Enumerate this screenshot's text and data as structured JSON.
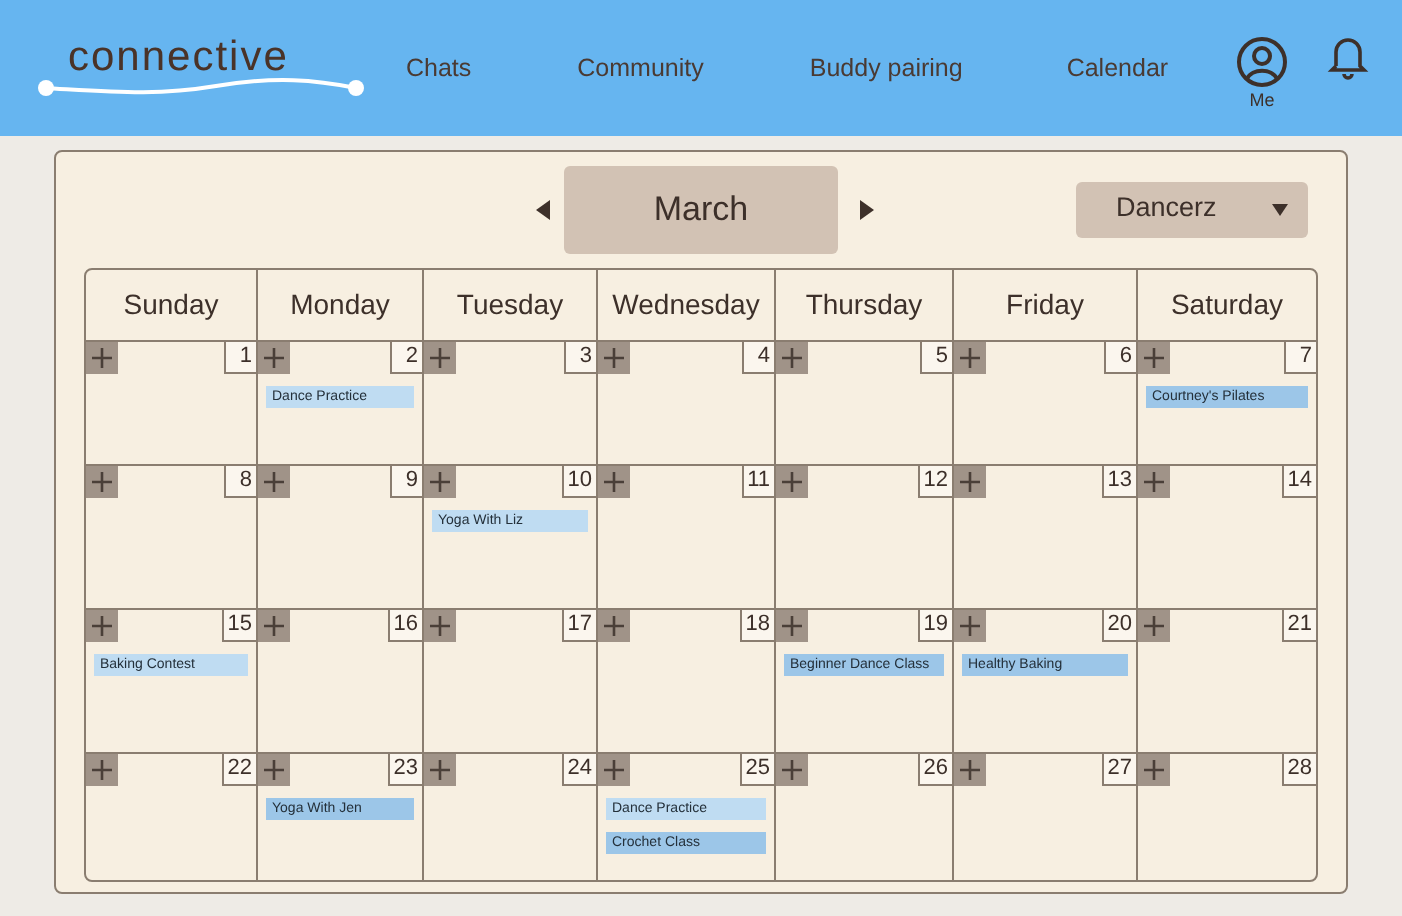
{
  "nav": {
    "logo": "connective",
    "links": [
      "Chats",
      "Community",
      "Buddy pairing",
      "Calendar"
    ],
    "profile_label": "Me"
  },
  "calendar": {
    "month": "March",
    "group": "Dancerz",
    "weekdays": [
      "Sunday",
      "Monday",
      "Tuesday",
      "Wednesday",
      "Thursday",
      "Friday",
      "Saturday"
    ],
    "weeks": [
      [
        {
          "day": "1"
        },
        {
          "day": "2",
          "events": [
            {
              "title": "Dance Practice",
              "color": "#bfdcf2"
            }
          ]
        },
        {
          "day": "3"
        },
        {
          "day": "4"
        },
        {
          "day": "5"
        },
        {
          "day": "6"
        },
        {
          "day": "7",
          "events": [
            {
              "title": "Courtney's Pilates",
              "color": "#9cc6e8"
            }
          ]
        }
      ],
      [
        {
          "day": "8"
        },
        {
          "day": "9"
        },
        {
          "day": "10",
          "events": [
            {
              "title": "Yoga With Liz",
              "color": "#bfdcf2"
            }
          ]
        },
        {
          "day": "11"
        },
        {
          "day": "12"
        },
        {
          "day": "13"
        },
        {
          "day": "14"
        }
      ],
      [
        {
          "day": "15",
          "events": [
            {
              "title": "Baking Contest",
              "color": "#bfdcf2"
            }
          ]
        },
        {
          "day": "16"
        },
        {
          "day": "17"
        },
        {
          "day": "18"
        },
        {
          "day": "19",
          "events": [
            {
              "title": "Beginner Dance Class",
              "color": "#9cc6e8"
            }
          ]
        },
        {
          "day": "20",
          "events": [
            {
              "title": "Healthy Baking",
              "color": "#9cc6e8"
            }
          ]
        },
        {
          "day": "21"
        }
      ],
      [
        {
          "day": "22"
        },
        {
          "day": "23",
          "events": [
            {
              "title": "Yoga With Jen",
              "color": "#9cc6e8"
            }
          ]
        },
        {
          "day": "24"
        },
        {
          "day": "25",
          "events": [
            {
              "title": "Dance Practice",
              "color": "#bfdcf2"
            },
            {
              "title": "Crochet Class",
              "color": "#9cc6e8"
            }
          ]
        },
        {
          "day": "26"
        },
        {
          "day": "27"
        },
        {
          "day": "28"
        }
      ]
    ]
  }
}
